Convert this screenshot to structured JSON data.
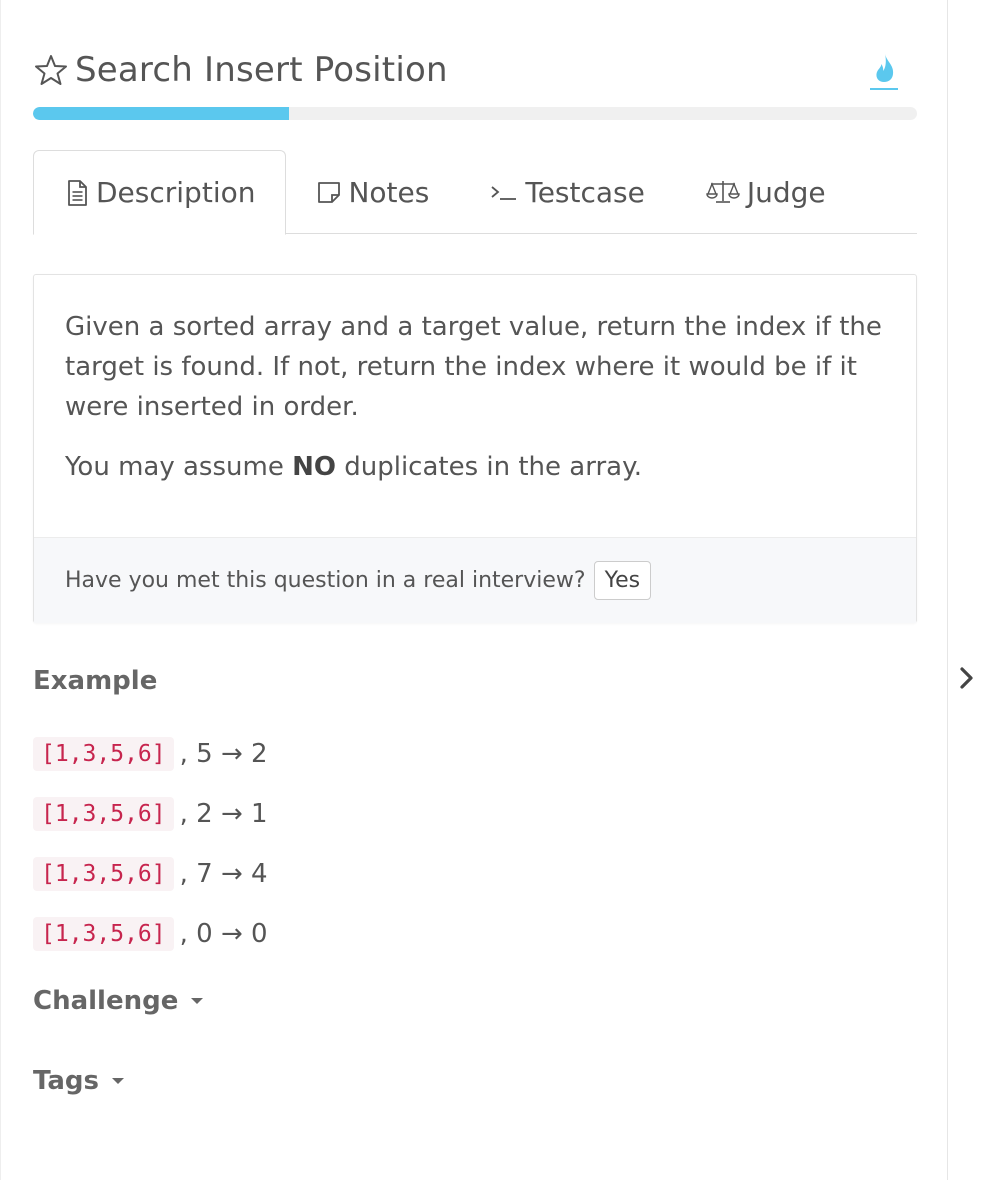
{
  "problem": {
    "title": "Search Insert Position",
    "progress_percent": 29
  },
  "tabs": [
    {
      "label": "Description",
      "icon": "document-icon",
      "active": true
    },
    {
      "label": "Notes",
      "icon": "note-icon",
      "active": false
    },
    {
      "label": "Testcase",
      "icon": "terminal-icon",
      "active": false
    },
    {
      "label": "Judge",
      "icon": "scale-icon",
      "active": false
    }
  ],
  "description": {
    "paragraph1": "Given a sorted array and a target value, return the index if the target is found. If not, return the index where it would be if it were inserted in order.",
    "paragraph2_before": "You may assume ",
    "paragraph2_bold": "NO",
    "paragraph2_after": " duplicates in the array.",
    "interview_question": "Have you met this question in a real interview?",
    "yes_label": "Yes"
  },
  "example": {
    "heading": "Example",
    "rows": [
      {
        "code": "[1,3,5,6]",
        "rest": ", 5 → 2"
      },
      {
        "code": "[1,3,5,6]",
        "rest": ", 2 → 1"
      },
      {
        "code": "[1,3,5,6]",
        "rest": ", 7 → 4"
      },
      {
        "code": "[1,3,5,6]",
        "rest": ", 0 → 0"
      }
    ]
  },
  "sections": {
    "challenge": "Challenge",
    "tags": "Tags"
  },
  "colors": {
    "accent": "#5bc8ee",
    "code_text": "#c7254e",
    "code_bg": "#f9f2f4"
  }
}
